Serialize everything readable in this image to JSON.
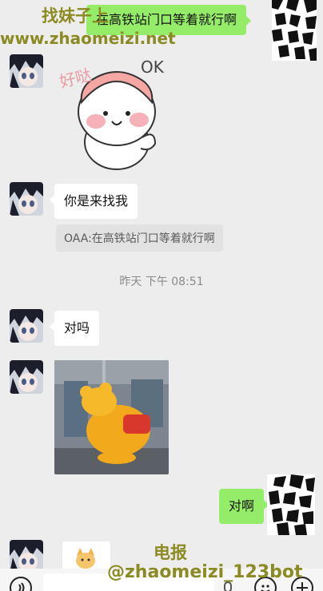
{
  "watermark": {
    "top_title": "找妹子上",
    "top_url": "www.zhaomeizi.net",
    "bottom_title": "电报",
    "bottom_handle": "@zhaomeizi_123bot"
  },
  "messages": {
    "m1_text": "在高铁站门口等着就行啊",
    "m2_sticker_text_cn": "好哒",
    "m2_sticker_text_en": "OK",
    "m3_text": "你是来找我",
    "m3_quote": "OAA:在高铁站门口等着就行啊",
    "timestamp": "昨天 下午 08:51",
    "m4_text": "对吗",
    "m6_text": "对啊"
  },
  "colors": {
    "background": "#ededed",
    "bubble_sent": "#95ec69",
    "bubble_received": "#ffffff",
    "watermark": "#8c8a22"
  },
  "icons": {
    "voice": "voice-icon",
    "emoji": "emoji-icon",
    "add": "plus-icon"
  }
}
